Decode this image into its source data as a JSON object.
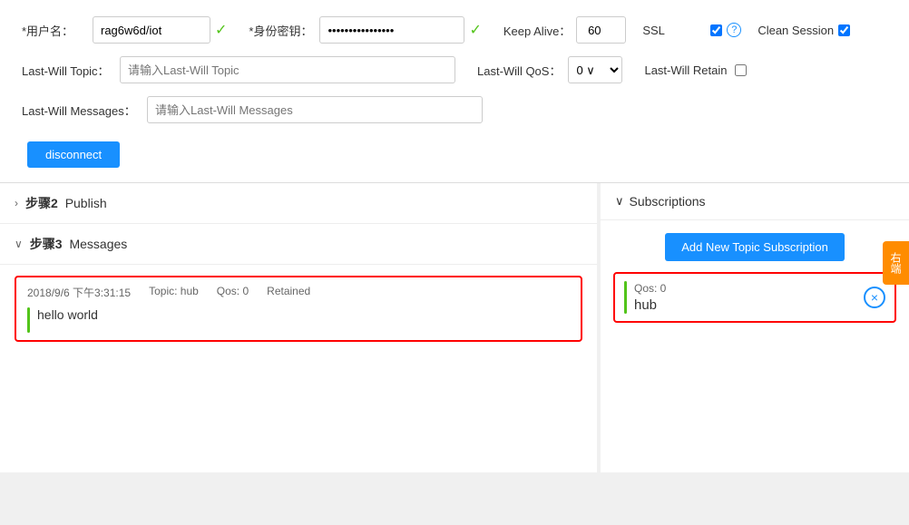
{
  "form": {
    "username_label": "*用户名：",
    "username_value": "rag6w6d/iot",
    "password_label": "*身份密钥：",
    "password_value": "••••••••••••••••",
    "keepalive_label": "Keep Alive：",
    "keepalive_value": "60",
    "ssl_label": "SSL",
    "clean_session_label": "Clean Session",
    "lastwill_topic_label": "Last-Will Topic：",
    "lastwill_topic_placeholder": "请输入Last-Will Topic",
    "lastwill_qos_label": "Last-Will QoS：",
    "lastwill_qos_value": "0",
    "lastwill_retain_label": "Last-Will Retain",
    "lastwill_messages_label": "Last-Will Messages：",
    "lastwill_messages_placeholder": "请输入Last-Will Messages",
    "disconnect_btn": "disconnect"
  },
  "publish_section": {
    "step": "步骤2",
    "title": "Publish"
  },
  "messages_section": {
    "step": "步骤3",
    "title": "Messages",
    "messages": [
      {
        "timestamp": "2018/9/6 下午3:31:15",
        "topic": "Topic: hub",
        "qos": "Qos: 0",
        "retained": "Retained",
        "text": "hello world"
      }
    ]
  },
  "subscriptions_section": {
    "title": "Subscriptions",
    "add_btn": "Add New Topic Subscription",
    "items": [
      {
        "qos": "Qos: 0",
        "topic": "hub"
      }
    ]
  },
  "right_tab": "右端",
  "icons": {
    "check": "✓",
    "chevron_right": "›",
    "chevron_down": "∨",
    "close": "×",
    "help": "?"
  }
}
